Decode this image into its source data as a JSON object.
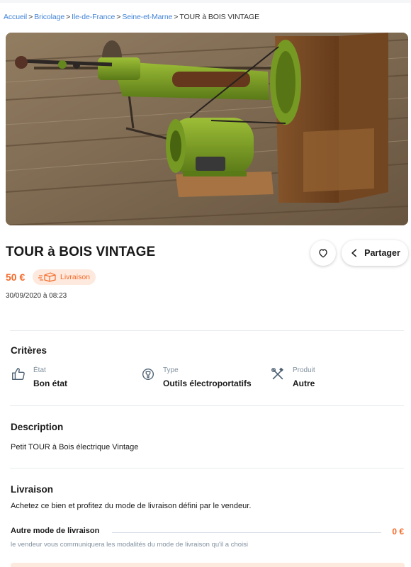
{
  "breadcrumb": {
    "items": [
      "Accueil",
      "Bricolage",
      "Ile-de-France",
      "Seine-et-Marne"
    ],
    "current": "TOUR à BOIS VINTAGE",
    "separator": ">"
  },
  "listing": {
    "title": "TOUR à BOIS VINTAGE",
    "price": "50 €",
    "delivery_badge": "Livraison",
    "date": "30/09/2020 à 08:23",
    "share_label": "Partager"
  },
  "criteria": {
    "title": "Critères",
    "items": [
      {
        "label": "État",
        "value": "Bon état",
        "icon": "thumbs-up-icon"
      },
      {
        "label": "Type",
        "value": "Outils électroportatifs",
        "icon": "tool-icon"
      },
      {
        "label": "Produit",
        "value": "Autre",
        "icon": "wrench-screwdriver-icon"
      }
    ]
  },
  "description": {
    "title": "Description",
    "text": "Petit TOUR à Bois électrique Vintage"
  },
  "delivery": {
    "title": "Livraison",
    "text": "Achetez ce bien et profitez du mode de livraison défini par le vendeur.",
    "other_mode_label": "Autre mode de livraison",
    "other_mode_price": "0 €",
    "other_mode_note": "le vendeur vous communiquera les modalités du mode de livraison qu'il a choisi"
  },
  "colors": {
    "accent": "#f56b2a",
    "link": "#4183d7",
    "muted": "#8191a0"
  }
}
